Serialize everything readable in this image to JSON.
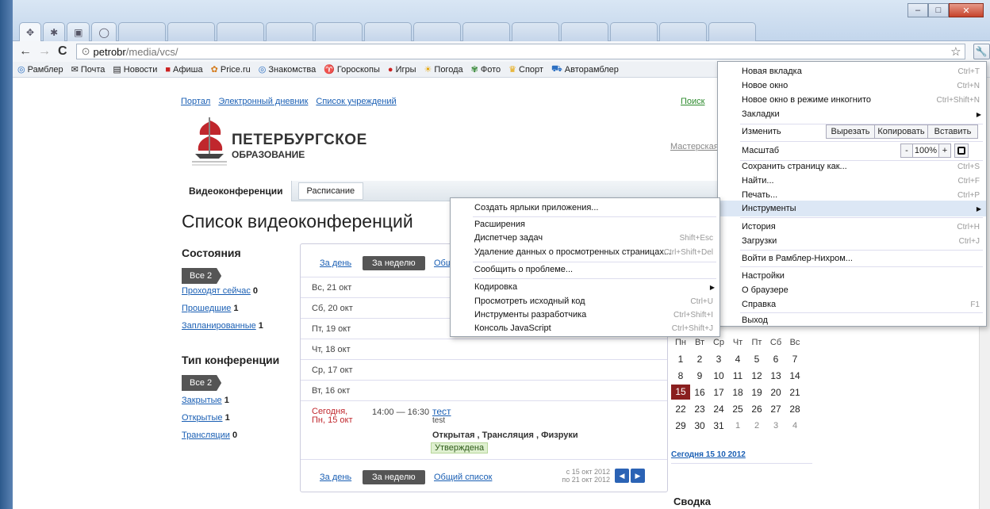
{
  "browser": {
    "address_host": "petrobr",
    "address_path": "/media/vcs/",
    "bookmarks": [
      "Рамблер",
      "Почта",
      "Новости",
      "Афиша",
      "Price.ru",
      "Знакомства",
      "Гороскопы",
      "Игры",
      "Погода",
      "Фото",
      "Спорт",
      "Авторамблер"
    ]
  },
  "site": {
    "topnav": [
      "Портал",
      "Электронный дневник",
      "Список учреждений"
    ],
    "search": "Поиск",
    "workshop": "Мастерская",
    "logo_line1": "ПЕТЕРБУРГСКОЕ",
    "logo_line2": "ОБРАЗОВАНИЕ",
    "tab_active": "Видеоконференции",
    "tab_other": "Расписание",
    "page_title": "Список видеоконференций",
    "states_title": "Состояния",
    "all_label": "Все 2",
    "states": [
      {
        "label": "Проходят сейчас",
        "count": "0"
      },
      {
        "label": "Прошедшие",
        "count": "1"
      },
      {
        "label": "Запланированные",
        "count": "1"
      }
    ],
    "type_title": "Тип конференции",
    "types": [
      {
        "label": "Закрытые",
        "count": "1"
      },
      {
        "label": "Открытые",
        "count": "1"
      },
      {
        "label": "Трансляции",
        "count": "0"
      }
    ]
  },
  "list": {
    "by_day": "За день",
    "by_week": "За неделю",
    "general_short": "Общ",
    "general": "Общий список",
    "days": [
      "Вс, 21 окт",
      "Сб, 20 окт",
      "Пт, 19 окт",
      "Чт, 18 окт",
      "Ср, 17 окт",
      "Вт, 16 окт"
    ],
    "today_line1": "Сегодня,",
    "today_line2": "Пн, 15 окт",
    "event_time": "14:00 — 16:30",
    "event_title": "тест",
    "event_sub": "test",
    "event_tags": "Открытая , Трансляция , Физруки",
    "event_status": "Утверждена",
    "range_from": "с 15 окт 2012",
    "range_to": "по 21 окт 2012"
  },
  "calendar": {
    "weekdays": [
      "Пн",
      "Вт",
      "Ср",
      "Чт",
      "Пт",
      "Сб",
      "Вс"
    ],
    "weeks": [
      [
        "1",
        "2",
        "3",
        "4",
        "5",
        "6",
        "7"
      ],
      [
        "8",
        "9",
        "10",
        "11",
        "12",
        "13",
        "14"
      ],
      [
        "15",
        "16",
        "17",
        "18",
        "19",
        "20",
        "21"
      ],
      [
        "22",
        "23",
        "24",
        "25",
        "26",
        "27",
        "28"
      ],
      [
        "29",
        "30",
        "31",
        "1",
        "2",
        "3",
        "4"
      ]
    ],
    "today_link": "Сегодня 15 10 2012",
    "summary": "Сводка"
  },
  "chrome_menu": {
    "new_tab": "Новая вкладка",
    "new_tab_sc": "Ctrl+T",
    "new_window": "Новое окно",
    "new_window_sc": "Ctrl+N",
    "incognito": "Новое окно в режиме инкогнито",
    "incognito_sc": "Ctrl+Shift+N",
    "bookmarks": "Закладки",
    "edit": "Изменить",
    "cut": "Вырезать",
    "copy": "Копировать",
    "paste": "Вставить",
    "zoom": "Масштаб",
    "zoom_minus": "-",
    "zoom_value": "100%",
    "zoom_plus": "+",
    "save": "Сохранить страницу как...",
    "save_sc": "Ctrl+S",
    "find": "Найти...",
    "find_sc": "Ctrl+F",
    "print": "Печать...",
    "print_sc": "Ctrl+P",
    "tools": "Инструменты",
    "history": "История",
    "history_sc": "Ctrl+H",
    "downloads": "Загрузки",
    "downloads_sc": "Ctrl+J",
    "signin": "Войти в Рамблер-Нихром...",
    "settings": "Настройки",
    "about": "О браузере",
    "help": "Справка",
    "help_sc": "F1",
    "exit": "Выход"
  },
  "tools_menu": {
    "shortcuts": "Создать ярлыки приложения...",
    "extensions": "Расширения",
    "task_manager": "Диспетчер задач",
    "task_manager_sc": "Shift+Esc",
    "clear_data": "Удаление данных о просмотренных страницах...",
    "clear_data_sc": "Ctrl+Shift+Del",
    "report": "Сообщить о проблеме...",
    "encoding": "Кодировка",
    "view_source": "Просмотреть исходный код",
    "view_source_sc": "Ctrl+U",
    "dev_tools": "Инструменты разработчика",
    "dev_tools_sc": "Ctrl+Shift+I",
    "js_console": "Консоль JavaScript",
    "js_console_sc": "Ctrl+Shift+J"
  }
}
